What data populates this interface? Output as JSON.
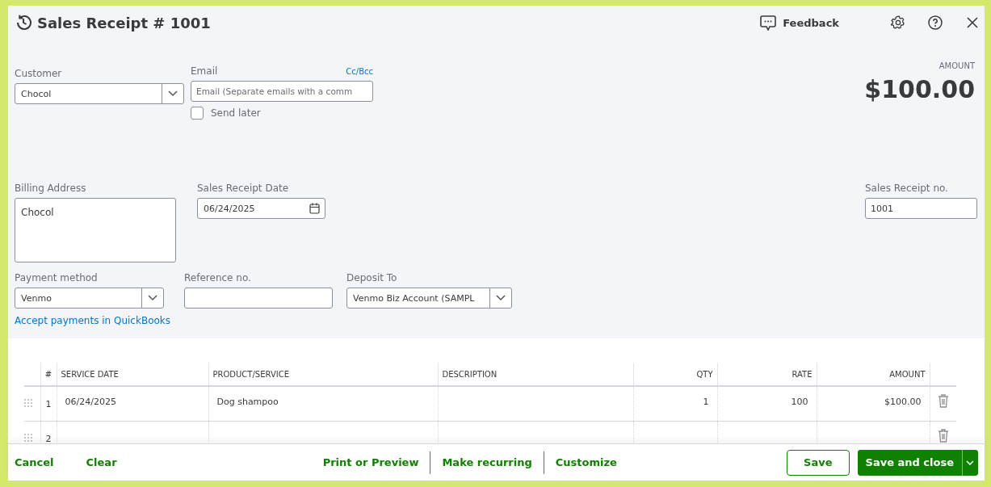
{
  "title": "Sales Receipt # 1001",
  "header_actions": {
    "feedback": "Feedback"
  },
  "customer": {
    "label": "Customer",
    "value": "Chocol"
  },
  "email": {
    "label": "Email",
    "cc_bcc": "Cc/Bcc",
    "placeholder": "Email (Separate emails with a comm",
    "send_later": {
      "label": "Send later",
      "checked": false
    }
  },
  "amount": {
    "label": "AMOUNT",
    "value": "$100.00"
  },
  "billing_address": {
    "label": "Billing Address",
    "value": "Chocol"
  },
  "sales_receipt_date": {
    "label": "Sales Receipt Date",
    "value": "06/24/2025"
  },
  "sales_receipt_no": {
    "label": "Sales Receipt no.",
    "value": "1001"
  },
  "payment_method": {
    "label": "Payment method",
    "value": "Venmo"
  },
  "reference_no": {
    "label": "Reference no."
  },
  "deposit_to": {
    "label": "Deposit To",
    "value": "Venmo Biz Account (SAMPL"
  },
  "accept_payments_link": "Accept payments in QuickBooks",
  "table": {
    "columns": [
      "#",
      "SERVICE DATE",
      "PRODUCT/SERVICE",
      "DESCRIPTION",
      "QTY",
      "RATE",
      "AMOUNT"
    ],
    "rows": [
      {
        "number": "1",
        "service_date": "06/24/2025",
        "product_service": "Dog shampoo",
        "qty": "1",
        "rate": "100",
        "amount": "$100.00"
      },
      {
        "number": "2"
      }
    ]
  },
  "footer": {
    "cancel": "Cancel",
    "clear": "Clear",
    "links": [
      "Print or Preview",
      "Make recurring",
      "Customize"
    ],
    "save": "Save",
    "save_and_close": "Save and close"
  }
}
